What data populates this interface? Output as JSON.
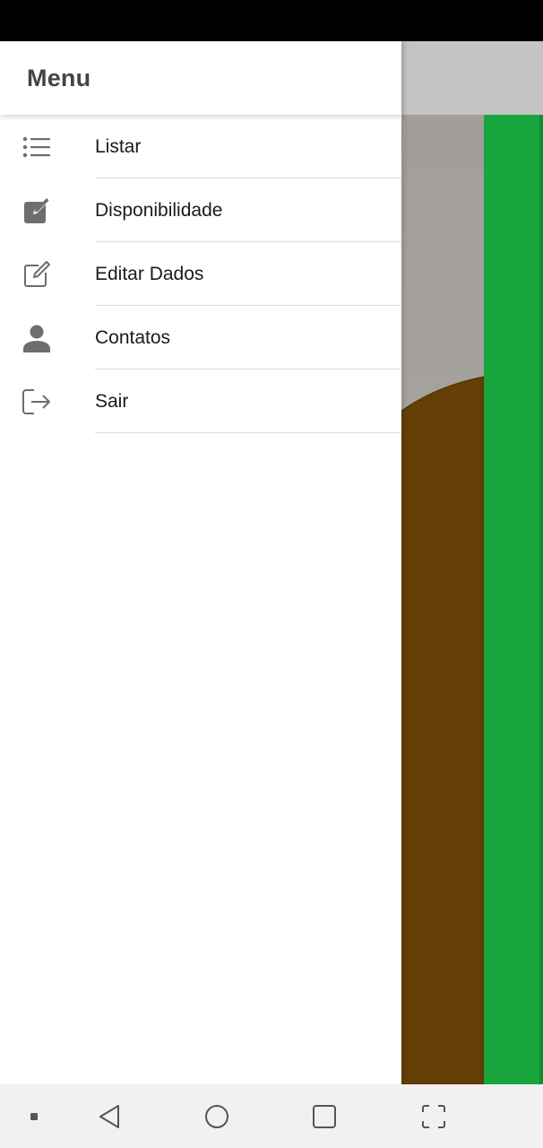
{
  "drawer": {
    "title": "Menu",
    "items": [
      {
        "label": "Listar",
        "icon": "list-icon"
      },
      {
        "label": "Disponibilidade",
        "icon": "edit-filled-icon"
      },
      {
        "label": "Editar Dados",
        "icon": "edit-outline-icon"
      },
      {
        "label": "Contatos",
        "icon": "person-icon"
      },
      {
        "label": "Sair",
        "icon": "logout-icon"
      }
    ]
  },
  "nav_bar": {
    "buttons": [
      "menu-dot-icon",
      "back-icon",
      "home-icon",
      "recents-icon",
      "fullscreen-icon"
    ]
  },
  "colors": {
    "status_bar": "#000000",
    "drawer_bg": "#ffffff",
    "icon": "#6e6e6e",
    "app_header": "#c4c4c4",
    "brown": "#633f05",
    "green": "#19a53e",
    "nav_bar": "#f1f1f1"
  }
}
